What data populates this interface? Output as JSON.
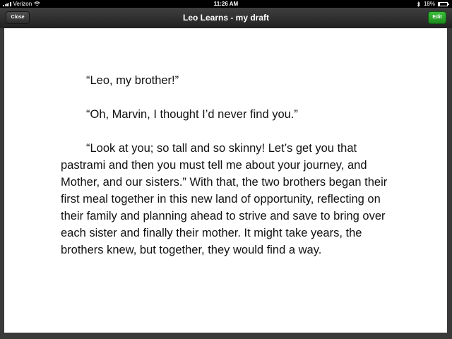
{
  "status_bar": {
    "carrier": "Verizon",
    "time": "11:26 AM",
    "battery_percent": "18%",
    "battery_level": 0.18,
    "icons": [
      "signal-icon",
      "wifi-icon",
      "bluetooth-icon",
      "battery-icon"
    ]
  },
  "nav": {
    "close_label": "Close",
    "title": "Leo Learns - my draft",
    "edit_label": "Edit",
    "edit_color": "#2aa82a"
  },
  "story": {
    "paragraphs": [
      "“Leo, my brother!”",
      "“Oh, Marvin, I thought I’d never find you.”",
      "“Look at you; so tall and so skinny! Let’s get you that pastrami and then you must tell me about your journey, and Mother, and our sisters.” With that, the two brothers began their first meal together in this new land of opportunity, reflecting on their family and planning ahead to strive and save to bring over each sister and finally their mother. It might take years, the brothers knew, but together, they would find a way."
    ]
  }
}
